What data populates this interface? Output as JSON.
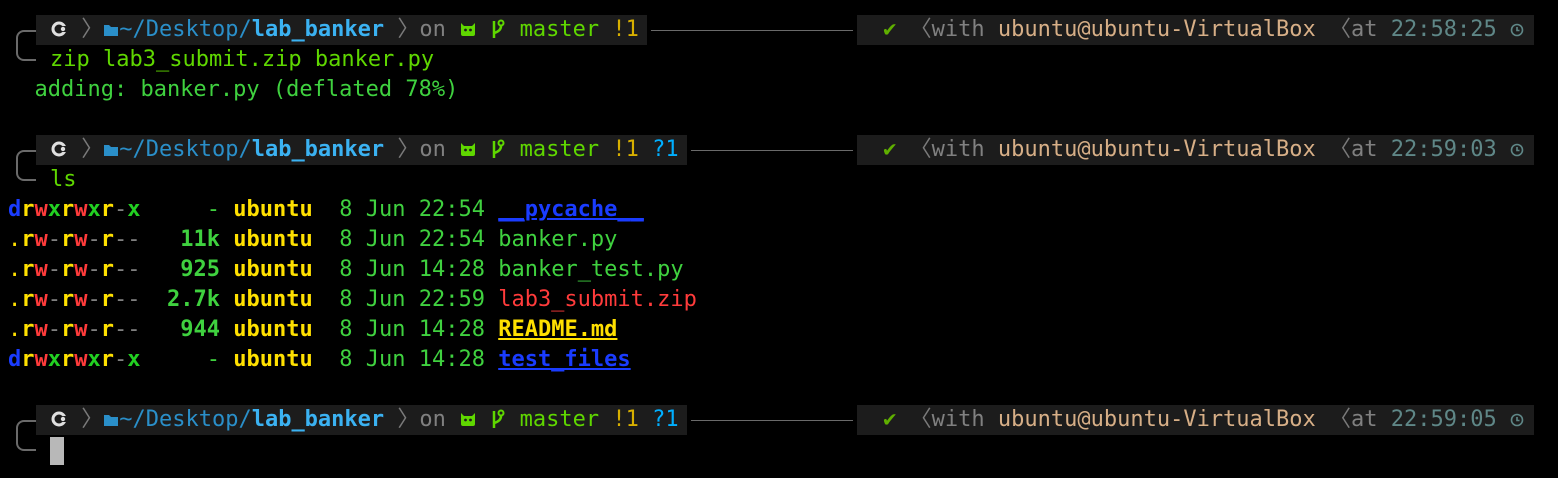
{
  "prompts": [
    {
      "dir_prefix": "~/Desktop/",
      "dir_name": "lab_banker",
      "on_label": "on",
      "branch": "master",
      "modified": "!1",
      "untracked": "",
      "check": "✔",
      "with_label": "with",
      "user_host": "ubuntu@ubuntu-VirtualBox",
      "at_label": "at",
      "time": "22:58:25"
    },
    {
      "dir_prefix": "~/Desktop/",
      "dir_name": "lab_banker",
      "on_label": "on",
      "branch": "master",
      "modified": "!1",
      "untracked": "?1",
      "check": "✔",
      "with_label": "with",
      "user_host": "ubuntu@ubuntu-VirtualBox",
      "at_label": "at",
      "time": "22:59:03"
    },
    {
      "dir_prefix": "~/Desktop/",
      "dir_name": "lab_banker",
      "on_label": "on",
      "branch": "master",
      "modified": "!1",
      "untracked": "?1",
      "check": "✔",
      "with_label": "with",
      "user_host": "ubuntu@ubuntu-VirtualBox",
      "at_label": "at",
      "time": "22:59:05"
    }
  ],
  "commands": {
    "first": "zip lab3_submit.zip banker.py",
    "second": "ls"
  },
  "zip_output": "  adding: banker.py (deflated 78%)",
  "listing": [
    {
      "perm": "drwxrwxr-x",
      "size": "-",
      "owner": "ubuntu",
      "day": "8",
      "month": "Jun",
      "time": "22:54",
      "name": "__pycache__",
      "kind": "dir"
    },
    {
      "perm": ".rw-rw-r--",
      "size": "11k",
      "owner": "ubuntu",
      "day": "8",
      "month": "Jun",
      "time": "22:54",
      "name": "banker.py",
      "kind": "py"
    },
    {
      "perm": ".rw-rw-r--",
      "size": "925",
      "owner": "ubuntu",
      "day": "8",
      "month": "Jun",
      "time": "14:28",
      "name": "banker_test.py",
      "kind": "py"
    },
    {
      "perm": ".rw-rw-r--",
      "size": "2.7k",
      "owner": "ubuntu",
      "day": "8",
      "month": "Jun",
      "time": "22:59",
      "name": "lab3_submit.zip",
      "kind": "zip"
    },
    {
      "perm": ".rw-rw-r--",
      "size": "944",
      "owner": "ubuntu",
      "day": "8",
      "month": "Jun",
      "time": "14:28",
      "name": "README.md",
      "kind": "readme"
    },
    {
      "perm": "drwxrwxr-x",
      "size": "-",
      "owner": "ubuntu",
      "day": "8",
      "month": "Jun",
      "time": "14:28",
      "name": "test_files",
      "kind": "dir"
    }
  ],
  "icons": {
    "os": "ubuntu-logo-icon",
    "folder": "folder-icon",
    "git": "github-cat-icon",
    "branch": "git-branch-icon",
    "clock": "clock-icon"
  },
  "colors": {
    "background": "#000000",
    "prompt_bar": "#1c1c1c",
    "dir": "#3bb2f2",
    "git_clean": "#5fd700",
    "git_modified": "#d7af00",
    "git_untracked": "#00afff",
    "user_host": "#d7af87",
    "time": "#5f8787"
  }
}
